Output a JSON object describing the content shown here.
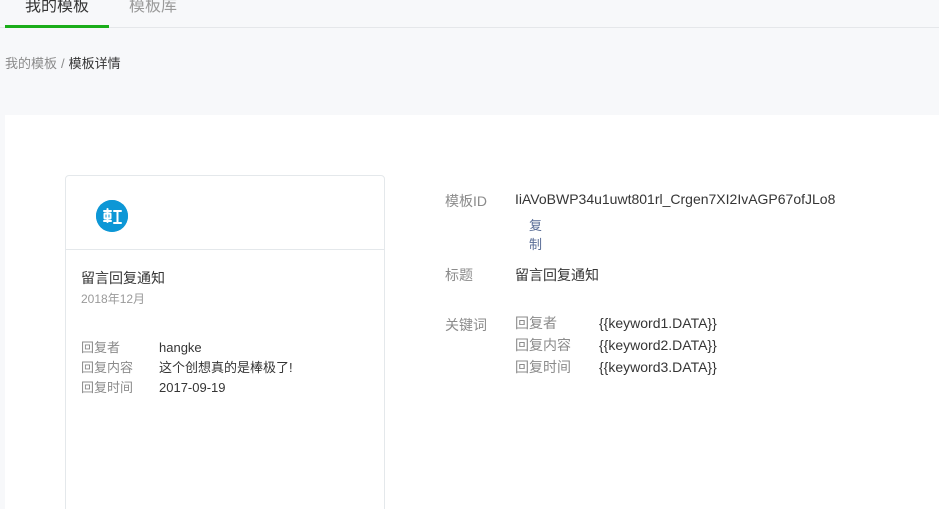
{
  "tabs": [
    {
      "label": "我的模板"
    },
    {
      "label": "模板库"
    }
  ],
  "breadcrumb": {
    "parent": "我的模板",
    "separator": "/",
    "current": "模板详情"
  },
  "card": {
    "logo_icon": "app-logo-icon",
    "title": "留言回复通知",
    "date": "2018年12月",
    "rows": [
      {
        "key": "回复者",
        "value": "hangke"
      },
      {
        "key": "回复内容",
        "value": "这个创想真的是棒极了!"
      },
      {
        "key": "回复时间",
        "value": "2017-09-19"
      }
    ]
  },
  "detail": {
    "template_id_label": "模板ID",
    "template_id_value": "IiAVoBWP34u1uwt801rl_Crgen7XI2IvAGP67ofJLo8",
    "copy_label": "复制",
    "title_label": "标题",
    "title_value": "留言回复通知",
    "keywords_label": "关键词",
    "keywords": [
      {
        "name": "回复者",
        "value": "{{keyword1.DATA}}"
      },
      {
        "name": "回复内容",
        "value": "{{keyword2.DATA}}"
      },
      {
        "name": "回复时间",
        "value": "{{keyword3.DATA}}"
      }
    ]
  },
  "colors": {
    "accent_green": "#1aad19",
    "link_blue": "#576b95",
    "logo_blue": "#0d97d6"
  }
}
